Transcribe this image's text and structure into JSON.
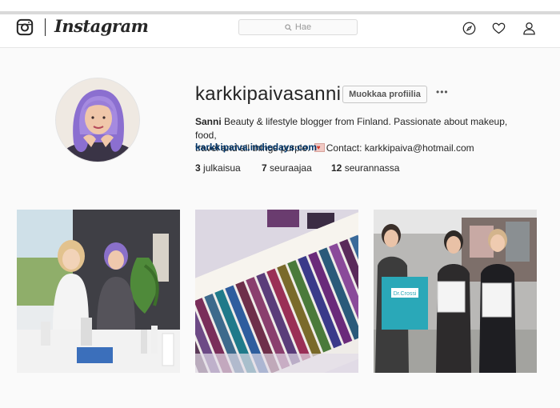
{
  "header": {
    "wordmark": "Instagram",
    "search_placeholder": "Hae",
    "icons": [
      "instagram-logo-icon",
      "search-icon",
      "compass-icon",
      "heart-icon",
      "person-icon"
    ]
  },
  "profile": {
    "username": "karkkipaivasanni",
    "edit_button": "Muokkaa profiilia",
    "options_label": "•••",
    "bio_name": "Sanni",
    "bio_line1": " Beauty & lifestyle blogger from Finland. Passionate about makeup, food,",
    "bio_line2a": "travel and all things purple. ",
    "bio_line2b": "Contact: karkkipaiva@hotmail.com",
    "link": "karkkipaiva.indiedays.com",
    "stats": [
      {
        "count": "3",
        "label": "julkaisua"
      },
      {
        "count": "7",
        "label": "seuraajaa"
      },
      {
        "count": "12",
        "label": "seurannassa"
      }
    ]
  },
  "posts": {
    "shopping_bag_text": "Dr.Crossi"
  },
  "colors": {
    "link": "#003569",
    "text": "#262626",
    "background": "#fafafa"
  }
}
